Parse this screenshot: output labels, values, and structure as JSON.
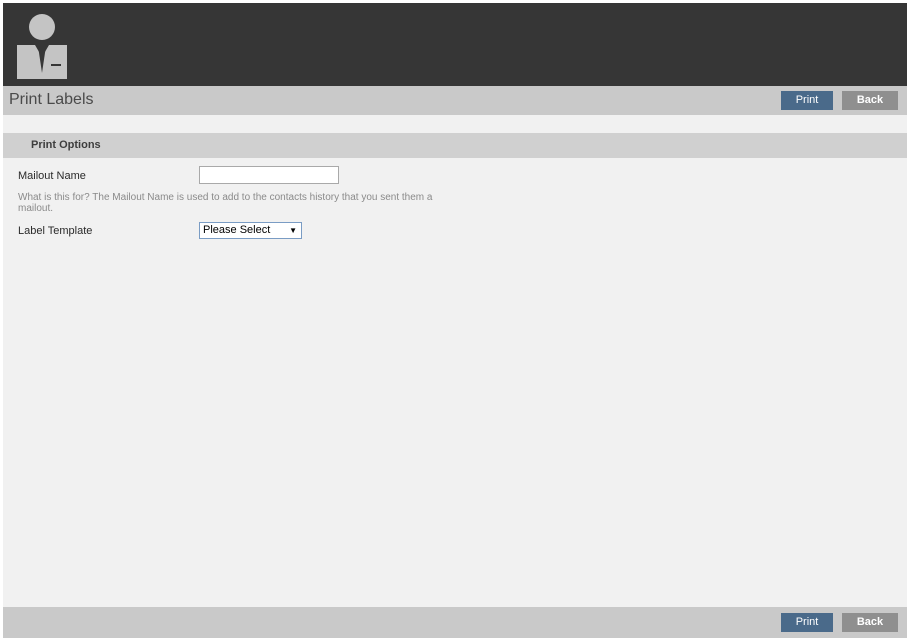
{
  "header": {
    "logo_icon": "user-profile-icon"
  },
  "titlebar": {
    "title": "Print Labels",
    "print_label": "Print",
    "back_label": "Back"
  },
  "section": {
    "title": "Print Options"
  },
  "form": {
    "mailout_name_label": "Mailout Name",
    "mailout_name_value": "",
    "mailout_help": "What is this for? The Mailout Name is used to add to the contacts history that you sent them a mailout.",
    "label_template_label": "Label Template",
    "label_template_selected": "Please Select"
  },
  "footer": {
    "print_label": "Print",
    "back_label": "Back"
  },
  "colors": {
    "header_bg": "#363636",
    "bar_bg": "#c9c9c9",
    "print_button": "#4a6a8a",
    "back_button": "#8f8f8f"
  }
}
